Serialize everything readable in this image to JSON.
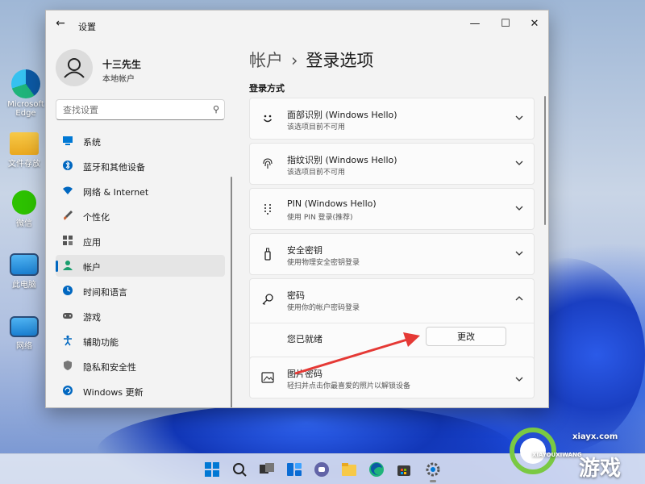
{
  "desktop": {
    "icons": [
      {
        "label": "Microsoft Edge"
      },
      {
        "label": "文件存放"
      },
      {
        "label": "微信"
      },
      {
        "label": "此电脑"
      },
      {
        "label": "网络"
      }
    ]
  },
  "window": {
    "title": "设置",
    "back_icon": "arrow-left-icon",
    "controls": {
      "minimize": "—",
      "maximize": "☐",
      "close": "✕"
    }
  },
  "sidebar": {
    "profile": {
      "name": "十三先生",
      "account_type": "本地帐户"
    },
    "search": {
      "placeholder": "查找设置"
    },
    "items": [
      {
        "label": "系统",
        "icon": "monitor-icon",
        "color": "#0078d4"
      },
      {
        "label": "蓝牙和其他设备",
        "icon": "bluetooth-icon",
        "color": "#0067c0"
      },
      {
        "label": "网络 & Internet",
        "icon": "wifi-icon",
        "color": "#0067c0"
      },
      {
        "label": "个性化",
        "icon": "brush-icon",
        "color": "#c75b2b"
      },
      {
        "label": "应用",
        "icon": "apps-icon",
        "color": "#555555"
      },
      {
        "label": "帐户",
        "icon": "person-icon",
        "color": "#1a9e6e",
        "active": true
      },
      {
        "label": "时间和语言",
        "icon": "globe-clock-icon",
        "color": "#0067c0"
      },
      {
        "label": "游戏",
        "icon": "gamepad-icon",
        "color": "#555555"
      },
      {
        "label": "辅助功能",
        "icon": "accessibility-icon",
        "color": "#0067c0"
      },
      {
        "label": "隐私和安全性",
        "icon": "shield-icon",
        "color": "#666666"
      },
      {
        "label": "Windows 更新",
        "icon": "update-icon",
        "color": "#0067c0"
      }
    ]
  },
  "main": {
    "breadcrumb": {
      "parent": "帐户",
      "separator": "›",
      "current": "登录选项"
    },
    "section_title": "登录方式",
    "options": [
      {
        "title": "面部识别 (Windows Hello)",
        "subtitle": "该选项目前不可用",
        "icon": "smile-icon",
        "chevron": "⌄"
      },
      {
        "title": "指纹识别 (Windows Hello)",
        "subtitle": "该选项目前不可用",
        "icon": "fingerprint-icon",
        "chevron": "⌄"
      },
      {
        "title": "PIN (Windows Hello)",
        "subtitle": "使用 PIN 登录(推荐)",
        "icon": "keypad-icon",
        "chevron": "⌄"
      },
      {
        "title": "安全密钥",
        "subtitle": "使用物理安全密钥登录",
        "icon": "usb-key-icon",
        "chevron": "⌄"
      },
      {
        "title": "密码",
        "subtitle": "使用你的帐户密码登录",
        "icon": "key-icon",
        "chevron": "⌃",
        "expanded": true,
        "detail_label": "您已就绪",
        "button_label": "更改"
      },
      {
        "title": "图片密码",
        "subtitle": "轻扫并点击你最喜爱的照片以解锁设备",
        "icon": "picture-icon",
        "chevron": "⌄"
      }
    ]
  },
  "annotation": {
    "arrow_color": "#e53935"
  },
  "taskbar": {
    "icons": [
      "windows-start-icon",
      "search-icon",
      "task-view-icon",
      "widgets-icon",
      "teams-chat-icon",
      "file-explorer-icon",
      "edge-icon",
      "store-icon",
      "settings-icon"
    ]
  },
  "watermark": {
    "site": "xiayx.com",
    "brand": "游戏",
    "small": "XIAYOUXIWANG"
  }
}
